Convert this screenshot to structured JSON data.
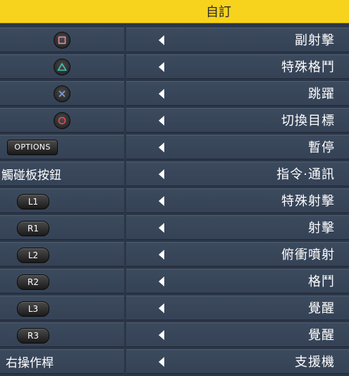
{
  "header": {
    "title": "自訂"
  },
  "rows": [
    {
      "input": "",
      "action": "副射擊"
    },
    {
      "input": "",
      "action": "特殊格鬥"
    },
    {
      "input": "",
      "action": "跳躍"
    },
    {
      "input": "",
      "action": "切換目標"
    },
    {
      "input": "OPTIONS",
      "action": "暫停"
    },
    {
      "input": "觸碰板按鈕",
      "action": "指令·通訊"
    },
    {
      "input": "L1",
      "action": "特殊射擊"
    },
    {
      "input": "R1",
      "action": "射擊"
    },
    {
      "input": "L2",
      "action": "俯衝噴射"
    },
    {
      "input": "R2",
      "action": "格鬥"
    },
    {
      "input": "L3",
      "action": "覺醒"
    },
    {
      "input": "R3",
      "action": "覺醒"
    },
    {
      "input": "右操作桿",
      "action": "支援機"
    }
  ],
  "colors": {
    "header": "#f7d31e",
    "square": "#e88aa6",
    "triangle": "#3fc7b7",
    "cross": "#7a9ce0",
    "circle": "#e54a5a"
  },
  "icons": [
    "square-button-icon",
    "triangle-button-icon",
    "cross-button-icon",
    "circle-button-icon",
    "left-arrow-icon"
  ]
}
